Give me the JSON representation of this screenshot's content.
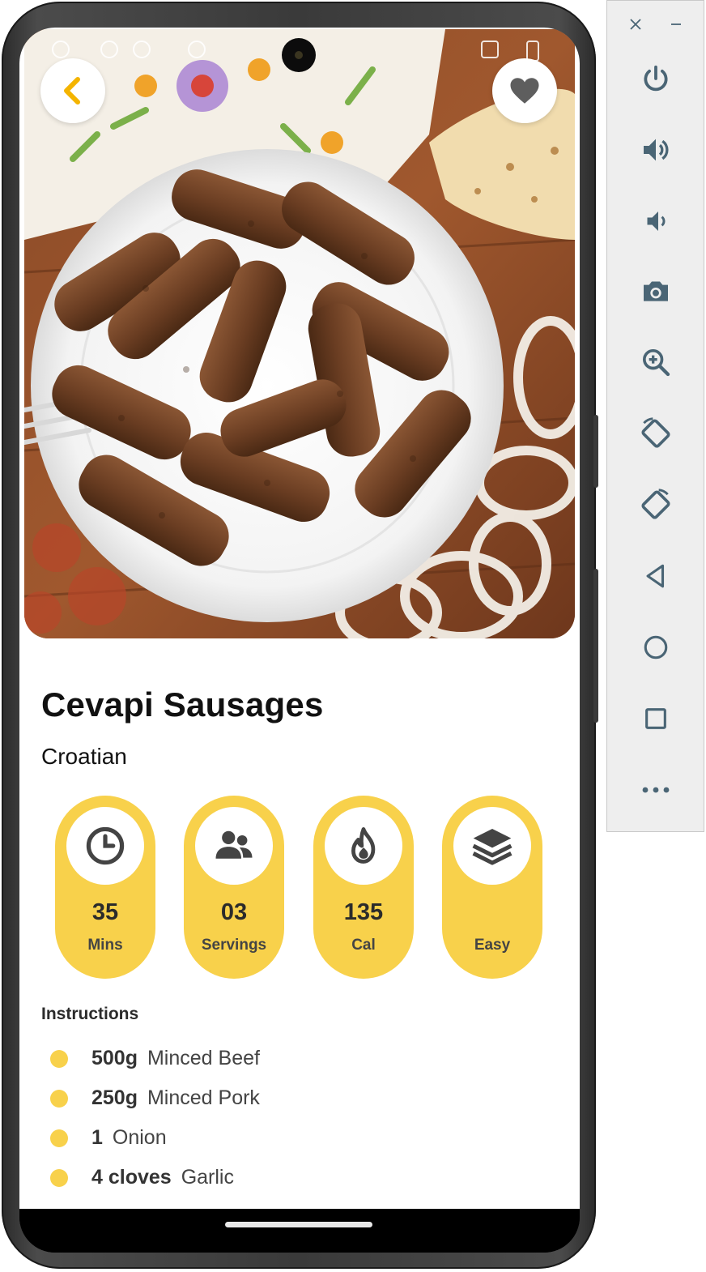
{
  "recipe": {
    "title": "Cevapi Sausages",
    "cuisine": "Croatian",
    "stats": [
      {
        "icon": "clock-icon",
        "value": "35",
        "label": "Mins"
      },
      {
        "icon": "people-icon",
        "value": "03",
        "label": "Servings"
      },
      {
        "icon": "fire-icon",
        "value": "135",
        "label": "Cal"
      },
      {
        "icon": "layers-icon",
        "value": "",
        "label": "Easy"
      }
    ],
    "section_title": "Instructions",
    "ingredients": [
      {
        "qty": "500g",
        "name": "Minced Beef"
      },
      {
        "qty": "250g",
        "name": "Minced Pork"
      },
      {
        "qty": "1",
        "name": "Onion"
      },
      {
        "qty": "4 cloves",
        "name": "Garlic"
      }
    ]
  },
  "header": {
    "back_icon": "chevron-left-icon",
    "favorite_icon": "heart-icon"
  },
  "emulator_toolbar": {
    "window_controls": [
      "close-icon",
      "minimize-icon"
    ],
    "buttons": [
      "power-icon",
      "volume-up-icon",
      "volume-down-icon",
      "camera-icon",
      "zoom-icon",
      "rotate-left-icon",
      "rotate-right-icon",
      "back-triangle-icon",
      "home-circle-icon",
      "overview-square-icon",
      "more-icon"
    ]
  },
  "colors": {
    "accent": "#f8d14b",
    "back_chevron": "#f4b400",
    "text_primary": "#111111",
    "toolbar_icon": "#4a6575"
  }
}
